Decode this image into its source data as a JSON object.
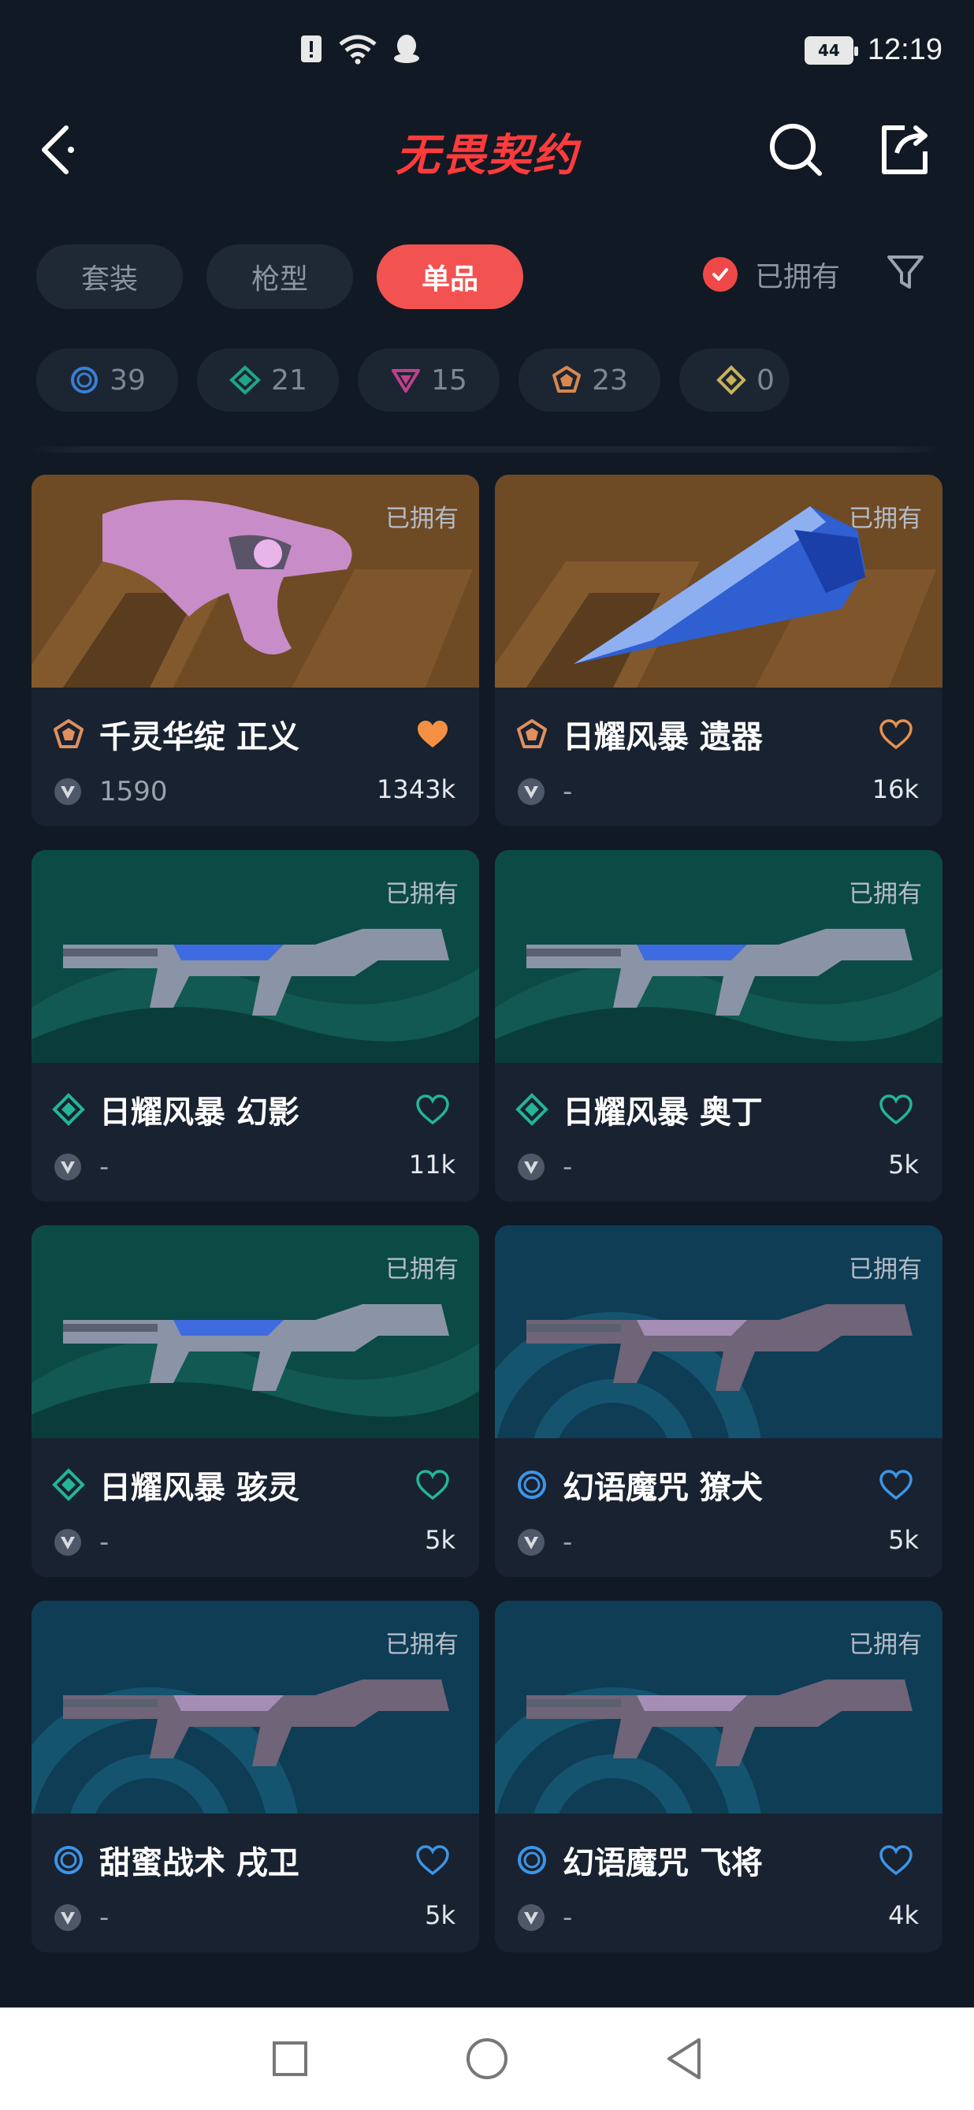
{
  "status_bar": {
    "battery": "44",
    "time": "12:19"
  },
  "header": {
    "title": "无畏契约"
  },
  "tabs": [
    {
      "label": "套装",
      "active": false
    },
    {
      "label": "枪型",
      "active": false
    },
    {
      "label": "单品",
      "active": true
    }
  ],
  "owned_filter": {
    "label": "已拥有",
    "checked": true
  },
  "rarity_chips": [
    {
      "icon": "select-tier-icon",
      "color": "#3a7fd6",
      "count": "39"
    },
    {
      "icon": "deluxe-tier-icon",
      "color": "#1fa58a",
      "count": "21"
    },
    {
      "icon": "premium-tier-icon",
      "color": "#c0408c",
      "count": "15"
    },
    {
      "icon": "ultra-tier-icon",
      "color": "#d7874f",
      "count": "23"
    },
    {
      "icon": "exclusive-tier-icon",
      "color": "#c9b25a",
      "count": "0"
    }
  ],
  "items": [
    {
      "name": "千灵华绽 正义",
      "owned_label": "已拥有",
      "tier": "ultra",
      "tier_color": "#e0905c",
      "price": "1590",
      "favorites": "1343k",
      "favorited": true,
      "fav_color": "#f39042",
      "bg": "orange"
    },
    {
      "name": "日耀风暴 遗器",
      "owned_label": "已拥有",
      "tier": "ultra",
      "tier_color": "#e0905c",
      "price": "-",
      "favorites": "16k",
      "favorited": false,
      "fav_color": "#e9904a",
      "bg": "orange"
    },
    {
      "name": "日耀风暴 幻影",
      "owned_label": "已拥有",
      "tier": "deluxe",
      "tier_color": "#23b596",
      "price": "-",
      "favorites": "11k",
      "favorited": false,
      "fav_color": "#22b596",
      "bg": "teal"
    },
    {
      "name": "日耀风暴 奥丁",
      "owned_label": "已拥有",
      "tier": "deluxe",
      "tier_color": "#23b596",
      "price": "-",
      "favorites": "5k",
      "favorited": false,
      "fav_color": "#22b596",
      "bg": "teal"
    },
    {
      "name": "日耀风暴 骇灵",
      "owned_label": "已拥有",
      "tier": "deluxe",
      "tier_color": "#23b596",
      "price": "-",
      "favorites": "5k",
      "favorited": false,
      "fav_color": "#22b596",
      "bg": "teal"
    },
    {
      "name": "幻语魔咒 獠犬",
      "owned_label": "已拥有",
      "tier": "select",
      "tier_color": "#3d95e6",
      "price": "-",
      "favorites": "5k",
      "favorited": false,
      "fav_color": "#3d95e6",
      "bg": "blue"
    },
    {
      "name": "甜蜜战术 戌卫",
      "owned_label": "已拥有",
      "tier": "select",
      "tier_color": "#3d95e6",
      "price": "-",
      "favorites": "5k",
      "favorited": false,
      "fav_color": "#3d95e6",
      "bg": "blue"
    },
    {
      "name": "幻语魔咒 飞将",
      "owned_label": "已拥有",
      "tier": "select",
      "tier_color": "#3d95e6",
      "price": "-",
      "favorites": "4k",
      "favorited": false,
      "fav_color": "#3d95e6",
      "bg": "blue"
    }
  ]
}
